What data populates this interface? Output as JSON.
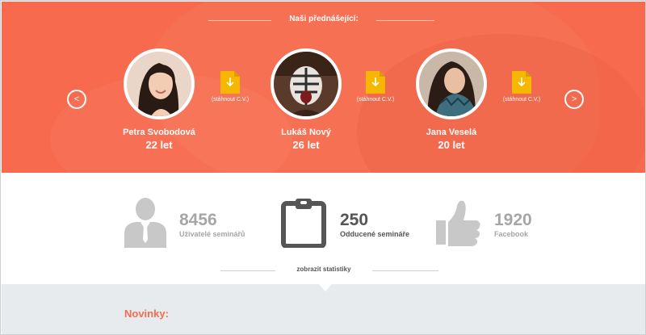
{
  "hero": {
    "title": "Naši přednášející:",
    "prev_symbol": "<",
    "next_symbol": ">",
    "speakers": [
      {
        "name": "Petra Svobodová",
        "age": "22 let"
      },
      {
        "name": "Lukáš Nový",
        "age": "26 let"
      },
      {
        "name": "Jana Veselá",
        "age": "20 let"
      }
    ],
    "cv_label": "(stáhnout C.V.)",
    "colors": {
      "background": "#f76a4d",
      "cv_icon": "#f5b700"
    }
  },
  "stats": {
    "items": [
      {
        "icon": "user-icon",
        "number": "8456",
        "label": "Uživatelé seminářů"
      },
      {
        "icon": "clipboard-icon",
        "number": "250",
        "label": "Odducené semináře"
      },
      {
        "icon": "thumbs-up-icon",
        "number": "1920",
        "label": "Facebook"
      }
    ],
    "show_stats_label": "zobrazit statistiky"
  },
  "news": {
    "title": "Novinky:",
    "accent": "#f76a4d"
  }
}
